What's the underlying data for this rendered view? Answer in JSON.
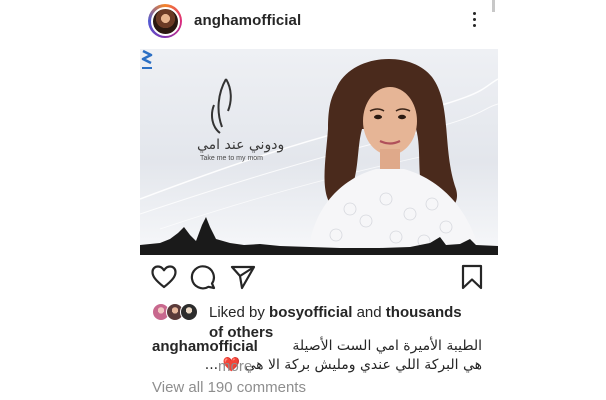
{
  "header": {
    "username": "anghamofficial"
  },
  "post_image": {
    "logo_arabic": "ودوني عند امي",
    "logo_english": "Take me to my mom"
  },
  "actions": {
    "like_icon": "heart-outline-icon",
    "comment_icon": "speech-bubble-icon",
    "share_icon": "paper-plane-icon",
    "save_icon": "bookmark-icon"
  },
  "likes": {
    "prefix": "Liked by ",
    "user": "bosyofficial",
    "middle": " and ",
    "rest": "thousands of others"
  },
  "caption": {
    "username": "anghamofficial",
    "line1": "الطيبة الأميرة امي الست الأصيلة",
    "line2": "هي البركة اللي عندي ومليش بركة الا هي",
    "heart": "❤️",
    "ellipsis": "...",
    "more": "more"
  },
  "comments": {
    "view_all": "View all 190 comments"
  },
  "colors": {
    "text": "#262626",
    "muted": "#8e8e8e",
    "heart": "#e0223a",
    "brand_blue": "#2b6fc4"
  }
}
